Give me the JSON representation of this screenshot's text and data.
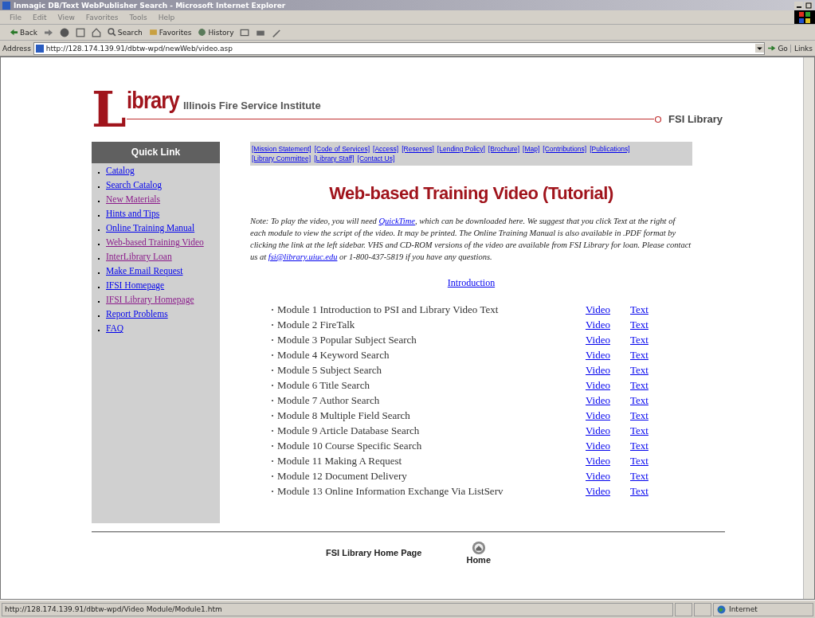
{
  "window": {
    "title": "Inmagic DB/Text WebPublisher Search - Microsoft Internet Explorer"
  },
  "menu": [
    "File",
    "Edit",
    "View",
    "Favorites",
    "Tools",
    "Help"
  ],
  "toolbar": {
    "back": "Back",
    "search": "Search",
    "favorites": "Favorites",
    "history": "History"
  },
  "address": {
    "label": "Address",
    "value": "http://128.174.139.91/dbtw-wpd/newWeb/video.asp",
    "go": "Go",
    "links": "Links"
  },
  "header": {
    "logo_letter": "L",
    "logo_word": "ibrary",
    "institute": "Illinois Fire Service Institute",
    "right": "FSI Library"
  },
  "sidebar": {
    "heading": "Quick Link",
    "items": [
      {
        "label": "Catalog",
        "visited": false
      },
      {
        "label": "Search Catalog",
        "visited": false
      },
      {
        "label": "New Materials",
        "visited": true
      },
      {
        "label": "Hints and Tips",
        "visited": false
      },
      {
        "label": "Online Training Manual",
        "visited": false
      },
      {
        "label": "Web-based Training Video",
        "visited": true
      },
      {
        "label": "InterLibrary Loan",
        "visited": true
      },
      {
        "label": "Make Email Request",
        "visited": false
      },
      {
        "label": "IFSI Homepage",
        "visited": false
      },
      {
        "label": "IFSI Library Homepage",
        "visited": true
      },
      {
        "label": "Report Problems",
        "visited": false
      },
      {
        "label": "FAQ",
        "visited": false
      }
    ]
  },
  "nav_links": [
    "[Mission Statement]",
    "[Code of Services]",
    "[Access]",
    "[Reserves]",
    "[Lending Policy]",
    "[Brochure]",
    "[Map]",
    "[Contributions]",
    "[Publications]",
    "[Library Committee]",
    "[Library Staff]",
    "[Contact Us]"
  ],
  "page_title": "Web-based Training Video (Tutorial)",
  "note": {
    "before": "Note: To play the video, you will need ",
    "link": "QuickTime",
    "middle": ", which can be downloaded here. We suggest that you click Text at the right of each module to view the script of the video. It may be printed. The Online Training Manual is also available in .PDF format by clicking the link at the left sidebar. VHS and CD-ROM versions of the video are available from FSI Library for loan. Please contact us at ",
    "email": "fsi@library.uiuc.edu",
    "after": " or 1-800-437-5819 if you have any questions."
  },
  "intro_link": "Introduction",
  "modules": [
    {
      "title": "Module 1 Introduction to PSI and Library Video Text",
      "video": "Video",
      "text": "Text"
    },
    {
      "title": "Module 2 FireTalk",
      "video": "Video",
      "text": "Text"
    },
    {
      "title": "Module 3 Popular Subject Search",
      "video": "Video",
      "text": "Text"
    },
    {
      "title": "Module 4 Keyword Search",
      "video": "Video",
      "text": "Text"
    },
    {
      "title": "Module 5 Subject Search",
      "video": "Video",
      "text": "Text"
    },
    {
      "title": "Module 6 Title Search",
      "video": "Video",
      "text": "Text"
    },
    {
      "title": "Module 7 Author Search",
      "video": "Video",
      "text": "Text"
    },
    {
      "title": "Module 8 Multiple Field Search",
      "video": "Video",
      "text": "Text"
    },
    {
      "title": "Module 9 Article Database Search",
      "video": "Video",
      "text": "Text"
    },
    {
      "title": "Module 10 Course Specific Search",
      "video": "Video",
      "text": "Text"
    },
    {
      "title": "Module 11 Making A Request",
      "video": "Video",
      "text": "Text"
    },
    {
      "title": "Module 12 Document Delivery",
      "video": "Video",
      "text": "Text"
    },
    {
      "title": "Module 13 Online Information Exchange Via ListServ",
      "video": "Video",
      "text": "Text"
    }
  ],
  "footer": {
    "home_page": "FSI Library Home Page",
    "home": "Home"
  },
  "status_bar": {
    "url": "http://128.174.139.91/dbtw-wpd/Video Module/Module1.htm",
    "zone": "Internet"
  }
}
